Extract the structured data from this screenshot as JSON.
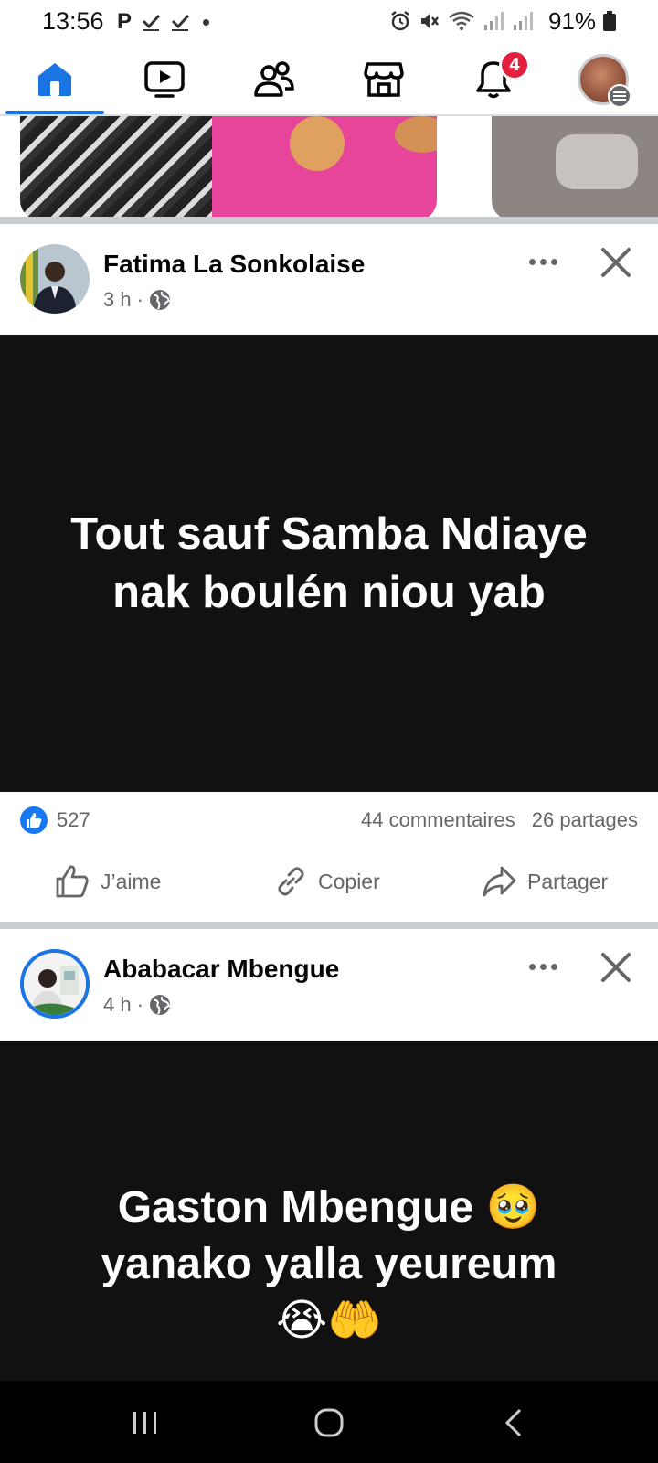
{
  "status_bar": {
    "time": "13:56",
    "battery_text": "91%"
  },
  "nav": {
    "items": [
      "home-icon",
      "video-icon",
      "friends-icon",
      "marketplace-icon",
      "notifications-icon",
      "profile-menu"
    ],
    "notification_badge": "4",
    "accent_color": "#1b74e4"
  },
  "posts": [
    {
      "author": "Fatima La Sonkolaise",
      "time": "3 h",
      "text": "Tout sauf Samba Ndiaye nak boulén niou yab",
      "likes": "527",
      "comments": "44 commentaires",
      "shares": "26 partages",
      "actions": {
        "like": "J’aime",
        "copy": "Copier",
        "share": "Partager"
      }
    },
    {
      "author": "Ababacar Mbengue",
      "time": "4 h",
      "text_line1": "Gaston Mbengue 🥹",
      "text_line2": "yanako yalla yeureum",
      "text_line3": "😭🤲"
    }
  ]
}
